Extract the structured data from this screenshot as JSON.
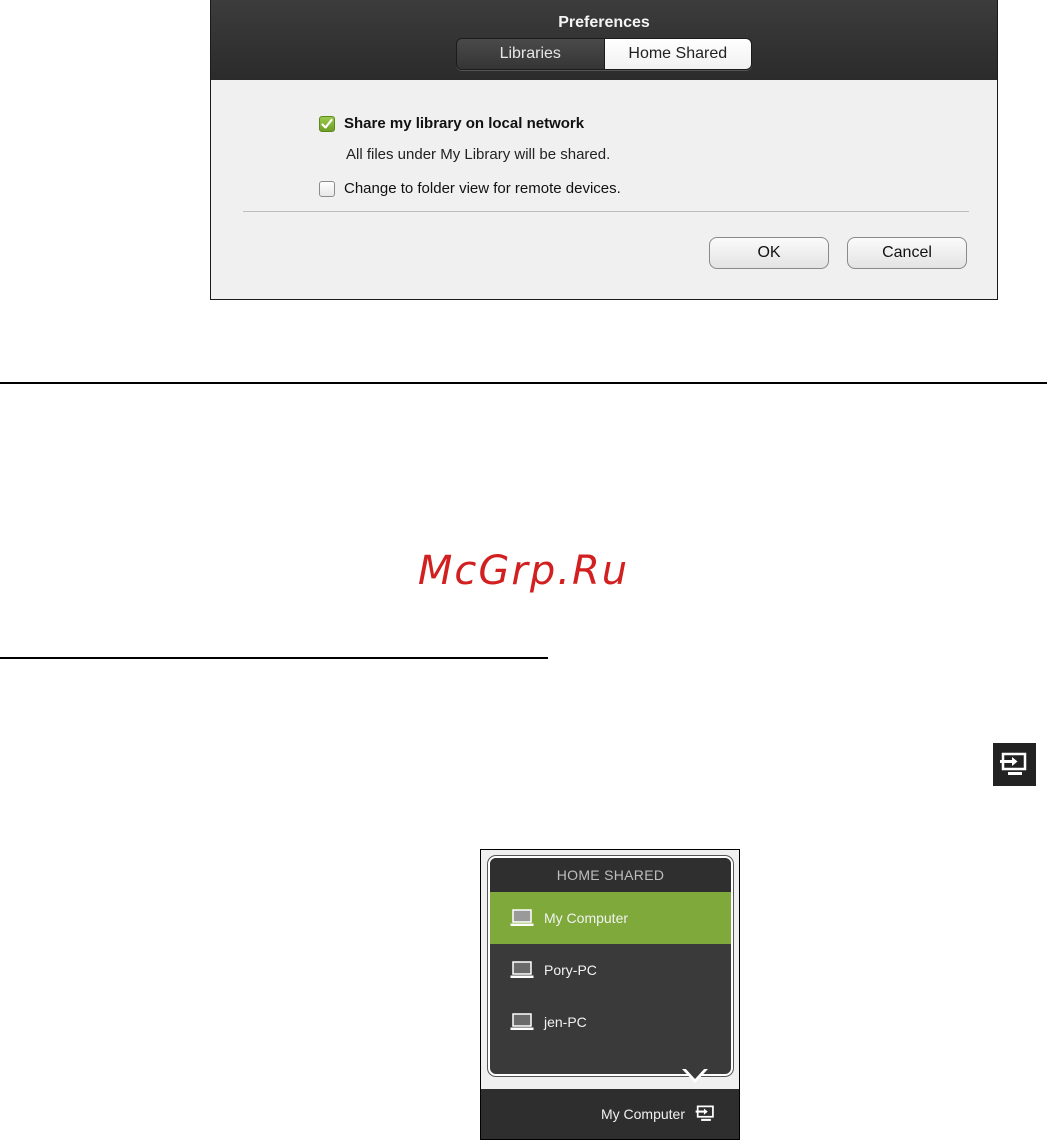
{
  "preferences": {
    "title": "Preferences",
    "tabs": [
      {
        "label": "Libraries",
        "selected": false
      },
      {
        "label": "Home Shared",
        "selected": true
      }
    ],
    "share_library": {
      "label": "Share my library on local network",
      "checked": true
    },
    "share_note": "All files under My Library will be shared.",
    "folder_view": {
      "label": "Change to folder view for remote devices.",
      "checked": false
    },
    "ok_label": "OK",
    "cancel_label": "Cancel",
    "accent_color": "#7fa93a"
  },
  "watermark": "McGrp.Ru",
  "home_shared": {
    "title": "HOME SHARED",
    "devices": [
      {
        "label": "My Computer",
        "active": true
      },
      {
        "label": "Pory-PC",
        "active": false
      },
      {
        "label": "jen-PC",
        "active": false
      }
    ],
    "current_device": "My Computer",
    "icons": {
      "device": "laptop-icon",
      "share": "home-share-icon"
    }
  }
}
